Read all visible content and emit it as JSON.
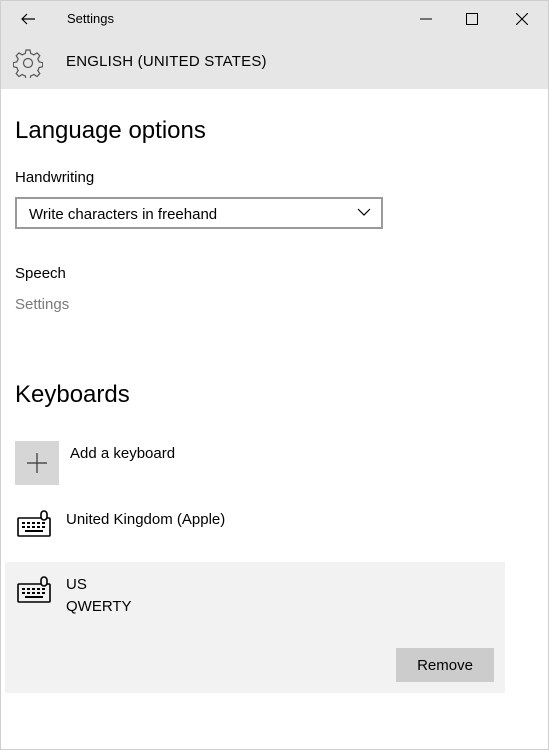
{
  "titlebar": {
    "title": "Settings",
    "back_icon": "back-arrow-icon",
    "minimize_icon": "minimize-icon",
    "maximize_icon": "maximize-icon",
    "close_icon": "close-icon"
  },
  "header": {
    "icon": "gear-icon",
    "title": "ENGLISH (UNITED STATES)"
  },
  "language_options": {
    "heading": "Language options",
    "handwriting_label": "Handwriting",
    "handwriting_value": "Write characters in freehand",
    "speech_label": "Speech",
    "speech_link": "Settings"
  },
  "keyboards": {
    "heading": "Keyboards",
    "add_label": "Add a keyboard",
    "items": [
      {
        "name": "United Kingdom (Apple)",
        "layout": ""
      },
      {
        "name": "US",
        "layout": "QWERTY",
        "selected": true
      }
    ],
    "remove_label": "Remove"
  },
  "colors": {
    "titlebar_bg": "#e6e6e6",
    "selected_row_bg": "#f2f2f2",
    "button_bg": "#cccccc",
    "link_gray": "#7a7a7a"
  }
}
